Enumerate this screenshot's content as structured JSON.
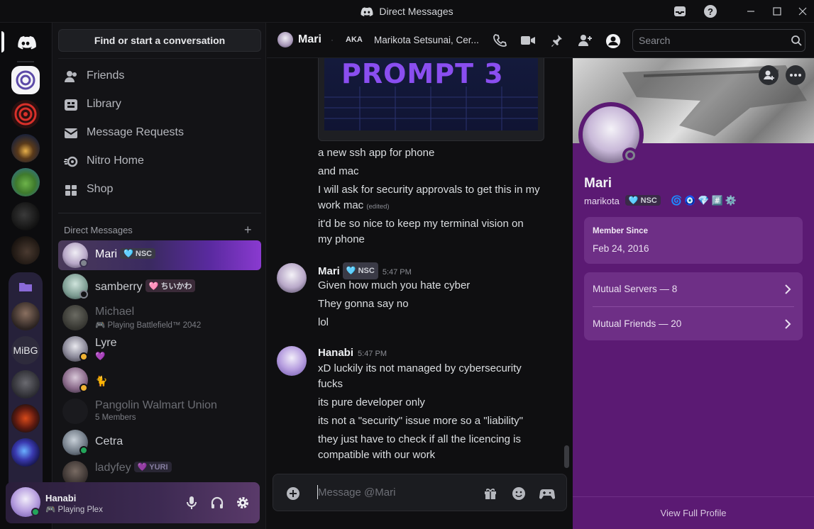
{
  "window": {
    "title": "Direct Messages"
  },
  "sidebar": {
    "find_button": "Find or start a conversation",
    "nav": [
      {
        "label": "Friends",
        "icon": "friends-icon"
      },
      {
        "label": "Library",
        "icon": "library-icon"
      },
      {
        "label": "Message Requests",
        "icon": "mail-icon"
      },
      {
        "label": "Nitro Home",
        "icon": "nitro-icon"
      },
      {
        "label": "Shop",
        "icon": "shop-icon"
      }
    ],
    "dm_header": "Direct Messages",
    "dms": [
      {
        "name": "Mari",
        "tag": "NSC",
        "sub": ""
      },
      {
        "name": "samberry",
        "tag": "ちいかわ",
        "sub": ""
      },
      {
        "name": "Michael",
        "tag": "",
        "sub": "Playing Battlefield™ 2042"
      },
      {
        "name": "Lyre",
        "tag": "",
        "sub": "💜"
      },
      {
        "name": "",
        "tag": "",
        "sub": "🐈"
      },
      {
        "name": "Pangolin Walmart Union",
        "tag": "",
        "sub": "5 Members"
      },
      {
        "name": "Cetra",
        "tag": "",
        "sub": ""
      },
      {
        "name": "ladyfey",
        "tag": "YURI",
        "sub": ""
      }
    ]
  },
  "user_panel": {
    "name": "Hanabi",
    "activity": "Playing Plex"
  },
  "chat_header": {
    "name": "Mari",
    "aka_label": "AKA",
    "aka_value": "Marikota Setsunai, Cer...",
    "search_placeholder": "Search"
  },
  "embed": {
    "text": "PROMPT 3"
  },
  "messages": [
    {
      "text": "a new ssh app for phone"
    },
    {
      "text": "and mac"
    },
    {
      "text": "I will ask for security approvals to get this in my work mac",
      "edited": "(edited)"
    },
    {
      "text": "it'd be so nice to keep my terminal vision on my phone"
    }
  ],
  "group_mari": {
    "name": "Mari",
    "tag": "NSC",
    "time": "5:47 PM",
    "lines": [
      "Given how much you hate cyber",
      "They gonna say no",
      "lol"
    ]
  },
  "group_hanabi": {
    "name": "Hanabi",
    "time": "5:47 PM",
    "lines": [
      "xD luckily its not managed by cybersecurity fucks",
      "its pure developer only",
      "its not a \"security\" issue more so a \"liability\"",
      "they just have to check if all the licencing is compatible with our work"
    ]
  },
  "composer": {
    "placeholder": "Message @Mari"
  },
  "profile": {
    "display_name": "Mari",
    "username": "marikota",
    "tag": "NSC",
    "member_since_label": "Member Since",
    "member_since": "Feb 24, 2016",
    "mutual_servers": "Mutual Servers — 8",
    "mutual_friends": "Mutual Friends — 20",
    "view_full": "View Full Profile"
  },
  "colors": {
    "accent": "#5865f2",
    "profile_bg": "#5b1a73",
    "online": "#23a55a"
  }
}
